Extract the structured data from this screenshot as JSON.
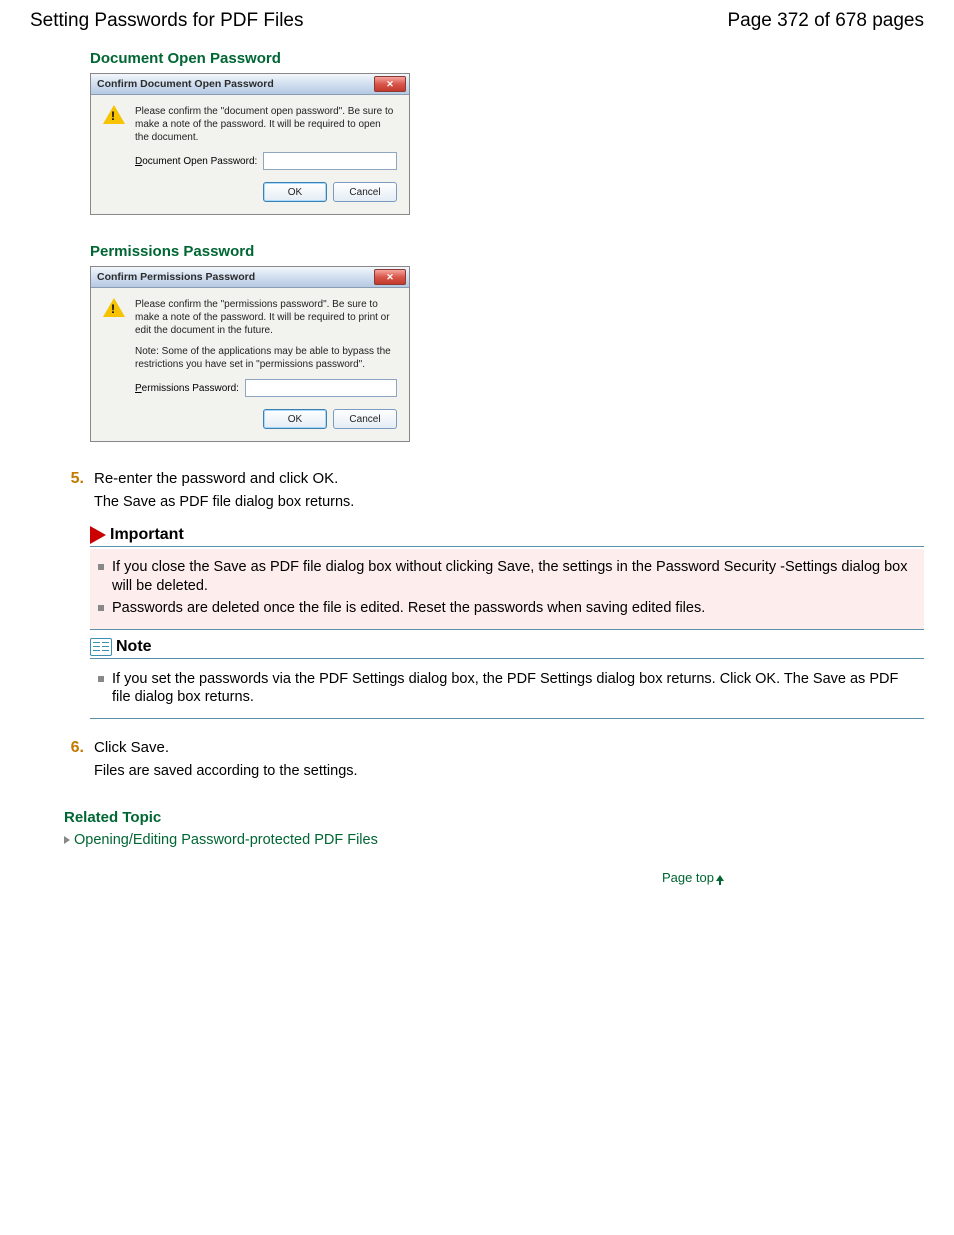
{
  "header": {
    "title": "Setting Passwords for PDF Files",
    "page_info": "Page 372 of 678 pages"
  },
  "sections": {
    "doc_open_title": "Document Open Password",
    "perm_title": "Permissions Password"
  },
  "dialog1": {
    "title": "Confirm Document Open Password",
    "message": "Please confirm the \"document open password\". Be sure to make a note of the password. It will be required to open the document.",
    "field_prefix_u": "D",
    "field_rest": "ocument Open Password:",
    "ok": "OK",
    "cancel": "Cancel"
  },
  "dialog2": {
    "title": "Confirm Permissions Password",
    "message": "Please confirm the \"permissions password\". Be sure to make a note of the password. It will be required to print or edit the document in the future.",
    "note": "Note: Some of the applications may be able to bypass the restrictions you have set in \"permissions password\".",
    "field_prefix_u": "P",
    "field_rest": "ermissions Password:",
    "ok": "OK",
    "cancel": "Cancel"
  },
  "step5": {
    "num": "5.",
    "text": "Re-enter the password and click OK.",
    "sub": "The Save as PDF file dialog box returns."
  },
  "important": {
    "title": "Important",
    "b1": "If you close the Save as PDF file dialog box without clicking Save, the settings in the Password Security -Settings dialog box will be deleted.",
    "b2": "Passwords are deleted once the file is edited. Reset the passwords when saving edited files."
  },
  "note": {
    "title": "Note",
    "b1": "If you set the passwords via the PDF Settings dialog box, the PDF Settings dialog box returns. Click OK. The Save as PDF file dialog box returns."
  },
  "step6": {
    "num": "6.",
    "text": "Click Save.",
    "sub": "Files are saved according to the settings."
  },
  "related": {
    "title": "Related Topic",
    "link": "Opening/Editing Password-protected PDF Files"
  },
  "page_top": "Page top"
}
